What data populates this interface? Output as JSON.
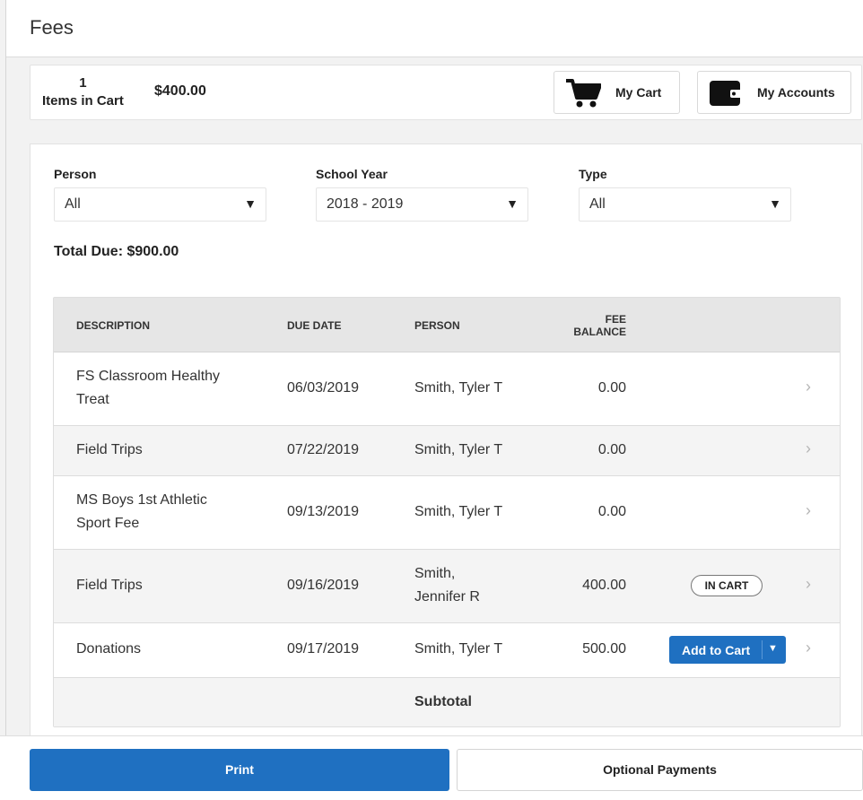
{
  "header": {
    "title": "Fees"
  },
  "cart": {
    "count": "1",
    "count_label": "Items in Cart",
    "total": "$400.00",
    "my_cart_label": "My Cart",
    "my_accounts_label": "My Accounts"
  },
  "filters": {
    "person": {
      "label": "Person",
      "value": "All"
    },
    "school_year": {
      "label": "School Year",
      "value": "2018 - 2019"
    },
    "type": {
      "label": "Type",
      "value": "All"
    }
  },
  "total_due": "Total Due: $900.00",
  "table": {
    "columns": {
      "description": "DESCRIPTION",
      "due_date": "DUE DATE",
      "person": "PERSON",
      "fee_balance_1": "FEE",
      "fee_balance_2": "BALANCE"
    },
    "rows": [
      {
        "description_1": "FS Classroom Healthy",
        "description_2": "Treat",
        "due_date": "06/03/2019",
        "person": "Smith, Tyler T",
        "balance": "0.00"
      },
      {
        "description": "Field Trips",
        "due_date": "07/22/2019",
        "person": "Smith, Tyler T",
        "balance": "0.00"
      },
      {
        "description_1": "MS Boys 1st Athletic",
        "description_2": "Sport Fee",
        "due_date": "09/13/2019",
        "person": "Smith, Tyler T",
        "balance": "0.00"
      },
      {
        "description": "Field Trips",
        "due_date": "09/16/2019",
        "person_1": "Smith,",
        "person_2": "Jennifer R",
        "balance": "400.00",
        "badge": "IN CART"
      },
      {
        "description": "Donations",
        "due_date": "09/17/2019",
        "person": "Smith, Tyler T",
        "balance": "500.00",
        "action": "Add to Cart"
      }
    ],
    "subtotal_label": "Subtotal"
  },
  "footer": {
    "print_label": "Print",
    "optional_payments_label": "Optional Payments"
  },
  "colors": {
    "primary": "#1f70c1",
    "header_bg": "#e6e6e6",
    "alt_row": "#f4f4f4"
  }
}
